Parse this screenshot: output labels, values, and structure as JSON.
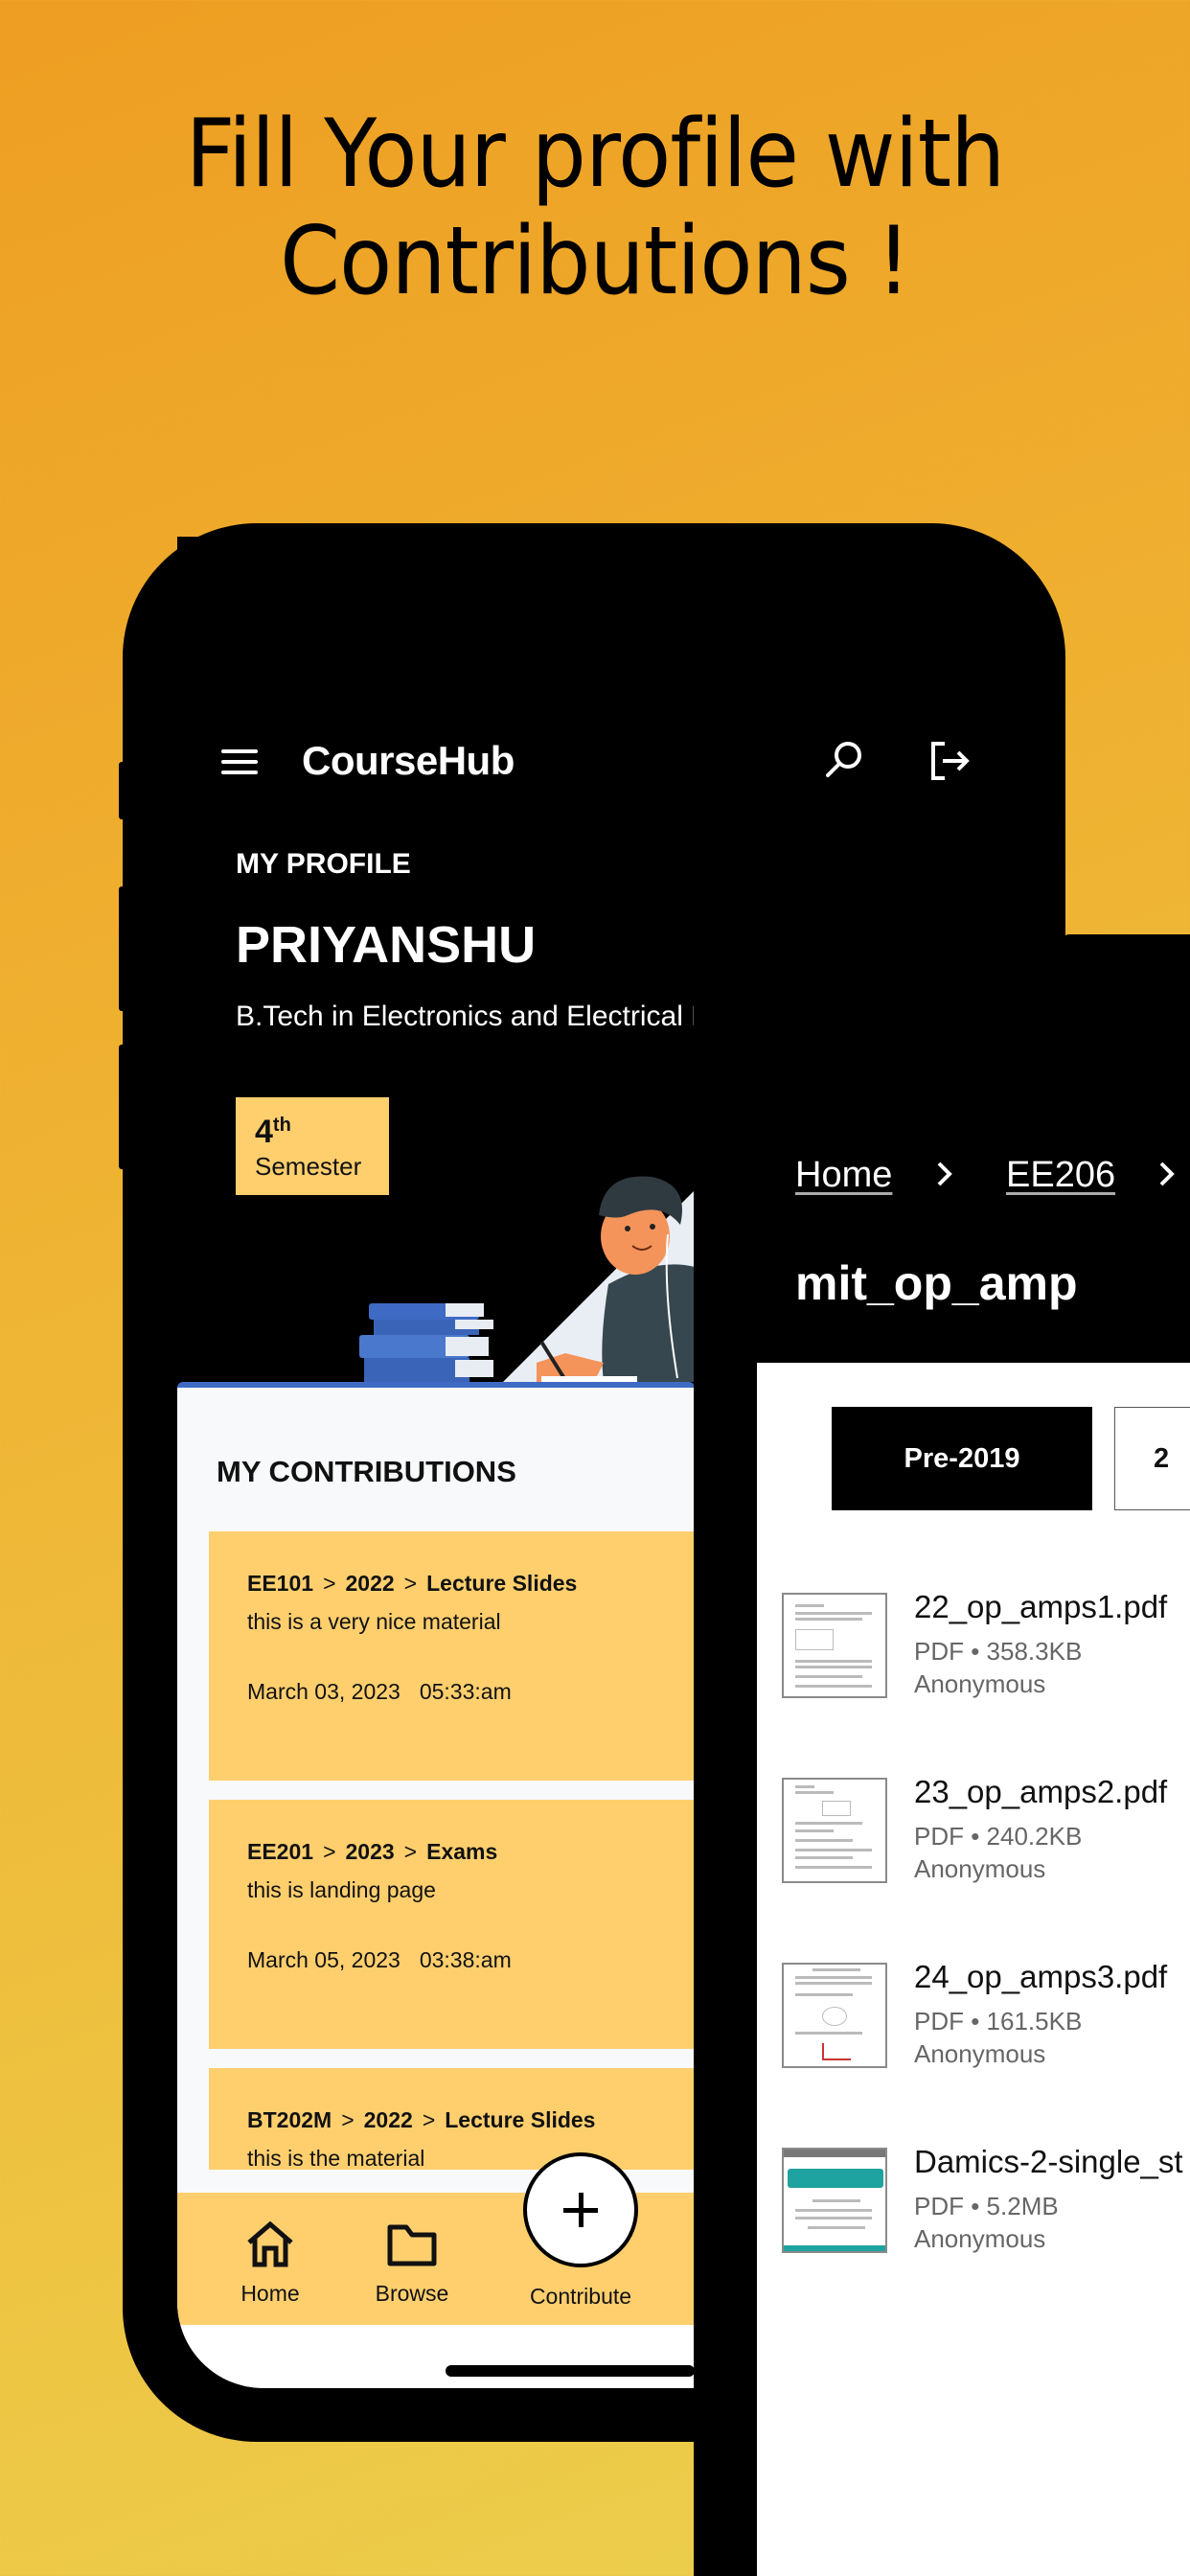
{
  "headline": {
    "line1": "Fill Your profile with",
    "line2": "Contributions !"
  },
  "profile_screen": {
    "app_name": "CourseHub",
    "icons": [
      "menu-icon",
      "search-icon",
      "logout-icon"
    ],
    "profile_label": "MY PROFILE",
    "name": "PRIYANSHU",
    "degree": "B.Tech in Electronics and Electrical E",
    "semester": {
      "number": "4",
      "suffix": "th",
      "label": "Semester"
    },
    "contributions_title": "MY CONTRIBUTIONS",
    "contributions": [
      {
        "course": "EE101",
        "year": "2022",
        "category": "Lecture Slides",
        "description": "this is a very nice material",
        "date": "March 03, 2023",
        "time": "05:33:am"
      },
      {
        "course": "EE201",
        "year": "2023",
        "category": "Exams",
        "description": "this is landing page",
        "date": "March 05, 2023",
        "time": "03:38:am"
      },
      {
        "course": "BT202M",
        "year": "2022",
        "category": "Lecture Slides",
        "description": "this is the material",
        "date": "",
        "time": ""
      }
    ],
    "path_separator": ">",
    "bottom_nav": {
      "home": "Home",
      "browse": "Browse",
      "contribute": "Contribute"
    }
  },
  "browse_screen": {
    "breadcrumb": [
      "Home",
      "EE206"
    ],
    "folder_title": "mit_op_amp",
    "tabs": [
      {
        "label": "Pre-2019",
        "active": true
      },
      {
        "label": "2",
        "active": false
      }
    ],
    "files": [
      {
        "name": "22_op_amps1.pdf",
        "meta": "PDF • 358.3KB",
        "owner": "Anonymous"
      },
      {
        "name": "23_op_amps2.pdf",
        "meta": "PDF • 240.2KB",
        "owner": "Anonymous"
      },
      {
        "name": "24_op_amps3.pdf",
        "meta": "PDF • 161.5KB",
        "owner": "Anonymous"
      },
      {
        "name": "Damics-2-single_st",
        "meta": "PDF • 5.2MB",
        "owner": "Anonymous"
      }
    ]
  },
  "colors": {
    "accent_yellow": "#ffcf6e",
    "background_orange": "#efb534",
    "desk_blue": "#3f6bc4"
  }
}
